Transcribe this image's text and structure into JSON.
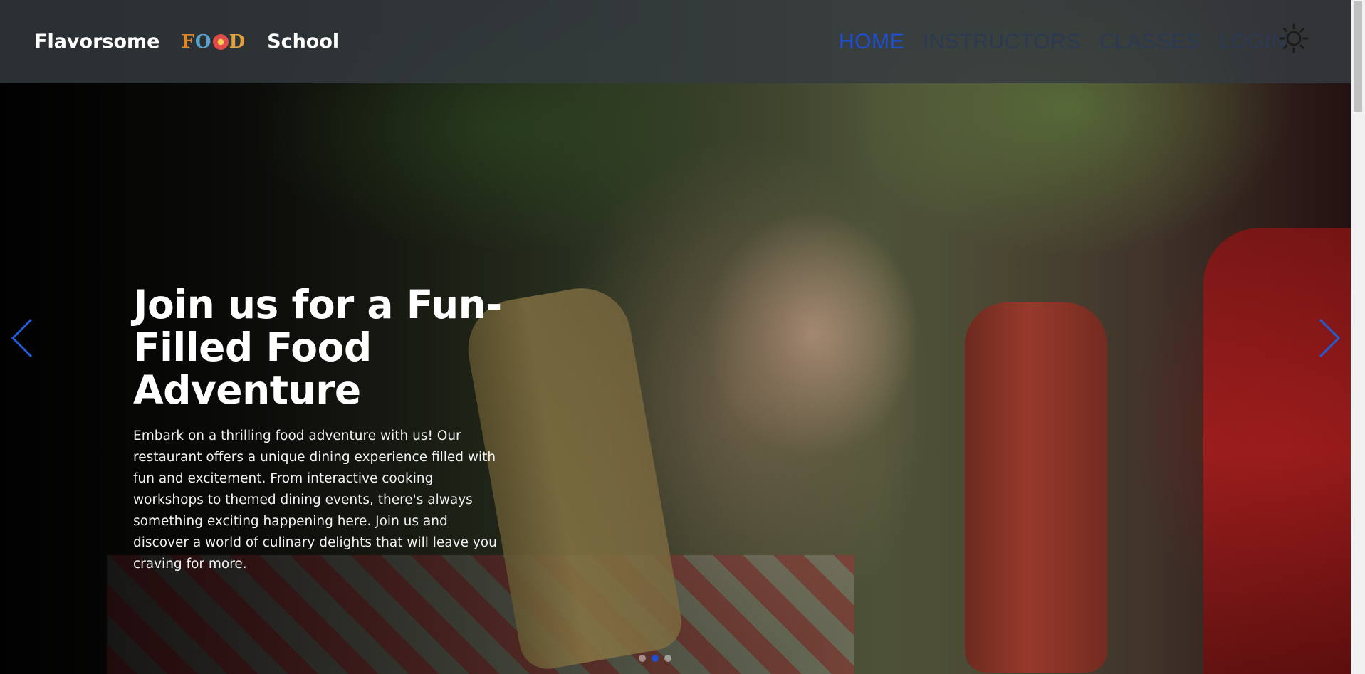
{
  "navbar": {
    "brand_left": "Flavorsome",
    "brand_right": "School",
    "logo_text": {
      "l1": "F",
      "l2": "O",
      "l3": "O",
      "l4": "D"
    },
    "links": [
      {
        "label": "HOME",
        "active": true
      },
      {
        "label": "INSTRUCTORS",
        "active": false
      },
      {
        "label": "CLASSES",
        "active": false
      },
      {
        "label": "LOGIN",
        "active": false
      }
    ],
    "theme_icon": "sun-icon"
  },
  "hero": {
    "title": "Join us for a Fun-Filled Food Adventure",
    "description": "Embark on a thrilling food adventure with us! Our restaurant offers a unique dining experience filled with fun and excitement. From interactive cooking workshops to themed dining events, there's always something exciting happening here. Join us and discover a world of culinary delights that will leave you craving for more.",
    "prev_icon": "chevron-left-icon",
    "next_icon": "chevron-right-icon",
    "slide_count": 3,
    "active_slide": 2
  },
  "colors": {
    "accent": "#1f4fd1",
    "nav_bg": "#343a40",
    "nav_inactive": "#2b3a52"
  }
}
